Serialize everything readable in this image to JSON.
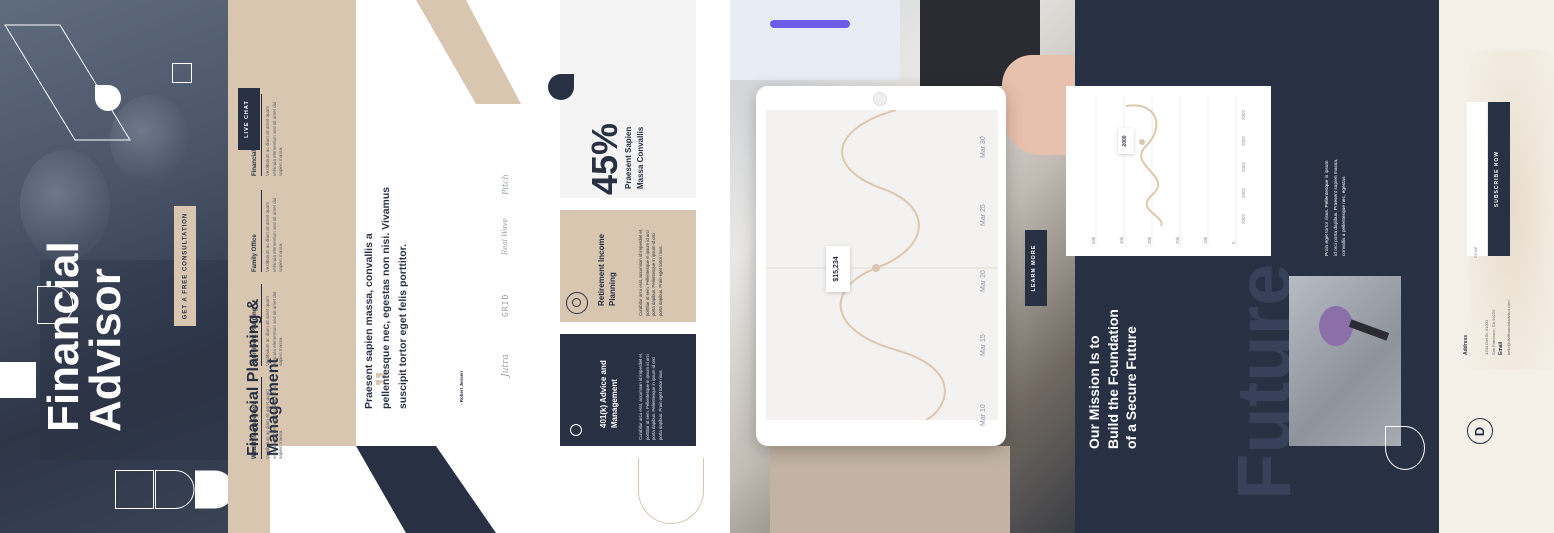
{
  "hero": {
    "title_line1": "Financial",
    "title_line2": "Advisor",
    "cta_label": "GET A FREE CONSULTATION"
  },
  "planning": {
    "live_chat_label": "LIVE CHAT",
    "heading": "Financial Planning & Management",
    "columns": [
      {
        "title": "Wealth Management",
        "text": "Vestibulum ac diam sit amet quam vehicula elementum sed sit amet dui sapien massa."
      },
      {
        "title": "Retirement Planning",
        "text": "Vestibulum ac diam sit amet quam vehicula elementum sed sit amet dui sapien massa."
      },
      {
        "title": "Family Office",
        "text": "Vestibulum ac diam sit amet quam vehicula elementum sed sit amet dui sapien massa."
      },
      {
        "title": "Financial Education",
        "text": "Vestibulum ac diam sit amet quam vehicula elementum sed sit amet dui sapien massa."
      }
    ]
  },
  "quote": {
    "mark": "”",
    "text_line1": "Praesent sapien massa, convallis a",
    "text_line2": "pellentesque nec, egestas non nisi. Vivamus",
    "text_line3": "suscipit tortor eget felis porttitor.",
    "author": "- Robert Jensen",
    "logos": [
      "Pitch",
      "Real Wave",
      "GRID",
      "Jutra"
    ]
  },
  "stats": {
    "percent": "45%",
    "percent_caption_line1": "Praesent Sapien",
    "percent_caption_line2": "Massa Convallis",
    "card1_title_line1": "Retirement Income",
    "card1_title_line2": "Planning",
    "card1_text": "Curabitur arcu erat, accumsan id imperdiet et, porttitor at sem. Pellentesque in ipsum id orci porta dapibus. Pellentesque in ipsum id orci porta dapibus. Proin eget tortor risus.",
    "card2_title_line1": "401(k) Advice and",
    "card2_title_line2": "Management",
    "card2_text": "Curabitur arcu erat, accumsan id imperdiet et, porttitor at sem. Pellentesque in ipsum id orci porta dapibus. Pellentesque in ipsum id orci porta dapibus. Proin eget tortor risus."
  },
  "tablet": {
    "value_label": "$15,234",
    "dates": [
      "Mar 10",
      "Mar 15",
      "Mar 20",
      "Mar 25",
      "Mar 30"
    ],
    "learn_more_label": "LEARN MORE"
  },
  "mission": {
    "heading_line1": "Our Mission Is to",
    "heading_line2": "Build the Foundation",
    "heading_line3": "of a Secure Future",
    "watermark": "Future",
    "text_line1": "Proin eget tortor risus. Pellentesque in ipsum",
    "text_line2": "id orci porta dapibus. Praesent sapien massa,",
    "text_line3": "convallis a pellentesque nec, egestas",
    "chart_tooltip": "2000",
    "chart_y_labels": [
      "0",
      "10k",
      "20k",
      "30k",
      "40k",
      "50k"
    ],
    "chart_x_labels": [
      "2002",
      "2002",
      "2002",
      "2002",
      "2002"
    ]
  },
  "contact": {
    "subscribe_label": "SUBSCRIBE NOW",
    "email_placeholder": "Email",
    "address_title": "Address",
    "address_line1": "1234 Divi St. #1000",
    "address_line2": "San Francisco, CA 94220",
    "email_title": "Email",
    "email_value": "hello@divifinancialadvisor.com",
    "logo_letter": "D"
  },
  "colors": {
    "navy": "#283143",
    "tan": "#d8c6b0",
    "cream": "#f4efe7"
  }
}
